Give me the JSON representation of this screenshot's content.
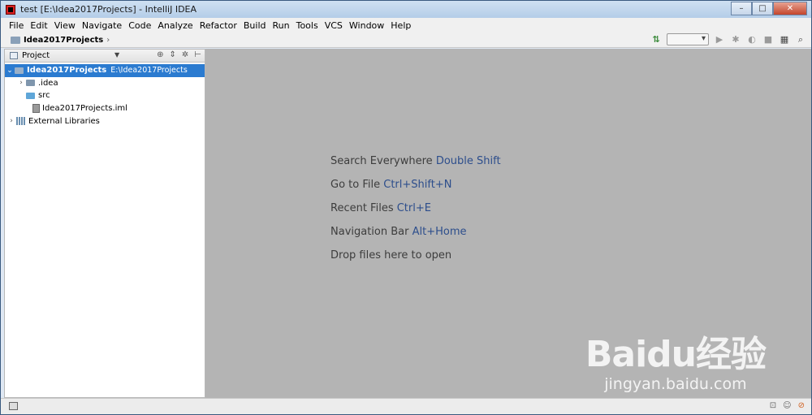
{
  "window": {
    "title": "test [E:\\Idea2017Projects] - IntelliJ IDEA",
    "minimize": "–",
    "maximize": "□",
    "close": "✕"
  },
  "menu": [
    "File",
    "Edit",
    "View",
    "Navigate",
    "Code",
    "Analyze",
    "Refactor",
    "Build",
    "Run",
    "Tools",
    "VCS",
    "Window",
    "Help"
  ],
  "navbar": {
    "crumb": "Idea2017Projects",
    "chevron": "›"
  },
  "project_panel": {
    "title": "Project",
    "tree": [
      {
        "label": "Idea2017Projects",
        "path": "E:\\Idea2017Projects",
        "expanded": true,
        "selected": true,
        "depth": 0,
        "icon": "folder-icon"
      },
      {
        "label": ".idea",
        "expanded": false,
        "depth": 1,
        "icon": "folder-icon"
      },
      {
        "label": "src",
        "depth": 1,
        "icon": "source-folder-icon"
      },
      {
        "label": "Idea2017Projects.iml",
        "depth": 1,
        "icon": "iml-file-icon"
      },
      {
        "label": "External Libraries",
        "expanded": false,
        "depth": 0,
        "icon": "library-icon"
      }
    ]
  },
  "editor": {
    "hints": [
      {
        "text": "Search Everywhere",
        "key": "Double Shift"
      },
      {
        "text": "Go to File",
        "key": "Ctrl+Shift+N"
      },
      {
        "text": "Recent Files",
        "key": "Ctrl+E"
      },
      {
        "text": "Navigation Bar",
        "key": "Alt+Home"
      },
      {
        "text": "Drop files here to open",
        "key": ""
      }
    ]
  },
  "watermark": {
    "logo": "Baidu经验",
    "url": "jingyan.baidu.com"
  },
  "colors": {
    "selection": "#2b7bd0",
    "editor_bg": "#b4b4b4",
    "hint_key": "#2d4e8c"
  }
}
